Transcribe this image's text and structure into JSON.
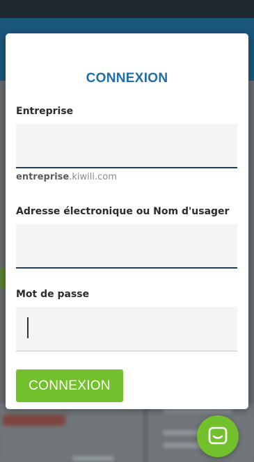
{
  "login_modal": {
    "title": "CONNEXION",
    "company_label": "Entreprise",
    "company_value": "",
    "company_hint_strong": "entreprise",
    "company_hint_domain": ".kiwili.com",
    "username_label": "Adresse électronique ou Nom d'usager",
    "username_value": "",
    "password_label": "Mot de passe",
    "password_value": "",
    "submit_label": "CONNEXION"
  },
  "colors": {
    "accent_blue": "#1e6ea8",
    "button_green": "#72c02c",
    "input_underline": "#1f3f5e"
  },
  "chat_widget": {
    "icon": "chat-icon"
  }
}
